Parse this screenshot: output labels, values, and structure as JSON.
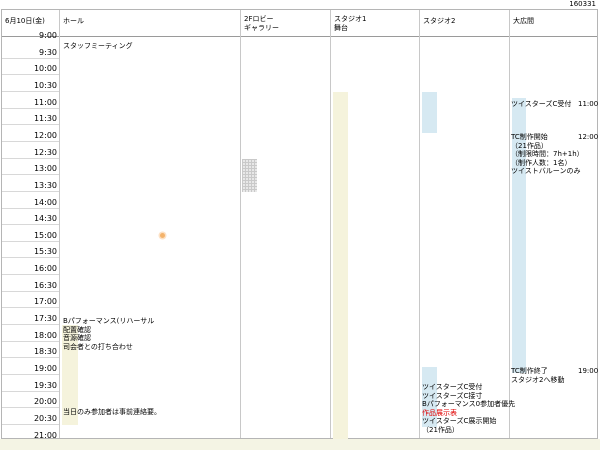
{
  "page_id": "160331",
  "header": {
    "date": "6月10日(金)",
    "columns": [
      {
        "key": "hall",
        "label": "ホール"
      },
      {
        "key": "lobby",
        "label": "2Fロビー\nギャラリー"
      },
      {
        "key": "studio1",
        "label": "スタジオ1\n舞台"
      },
      {
        "key": "studio2",
        "label": "スタジオ2"
      },
      {
        "key": "hiroma",
        "label": "大広間"
      }
    ]
  },
  "times": [
    "9:00",
    "9:30",
    "10:00",
    "10:30",
    "11:00",
    "11:30",
    "12:00",
    "12:30",
    "13:00",
    "13:30",
    "14:00",
    "14:30",
    "15:00",
    "15:30",
    "16:00",
    "16:30",
    "17:00",
    "17:30",
    "18:00",
    "18:30",
    "19:00",
    "19:30",
    "20:00",
    "20:30",
    "21:00"
  ],
  "events": {
    "hall_meeting": "スタッフミーティング",
    "hall_rehearsal": "Bパフォーマンス(リハーサル",
    "hall_placement": "配置確認",
    "hall_sound": "音源確認",
    "hall_mc": "司会者との打ち合わせ",
    "hall_note": "当日のみ参加者は事前連絡要。",
    "hiroma_reception": "ツイスターズC受付",
    "hiroma_reception_time": "11:00",
    "hiroma_start": "TC制作開始",
    "hiroma_start_time": "12:00",
    "hiroma_works": "（21作品）",
    "hiroma_limit": "（制限時間：7h+1h）",
    "hiroma_people": "（制作人数：1名）",
    "hiroma_balloon": "ツイストバルーンのみ",
    "hiroma_end": "TC制作終了",
    "hiroma_end_time": "19:00",
    "hiroma_move": "スタジオ2へ移動",
    "studio2_reception": "ツイスターズC受付",
    "studio2_removal": "ツイスターズC接寸",
    "studio2_priority": "Bパフォーマンス0参加者優先",
    "studio2_show": "作品展示表",
    "studio2_display": "ツイスターズC展示開始",
    "studio2_works": "（21作品）"
  },
  "colors": {
    "studio_bar": "#f5f3dc",
    "blue_bar": "#d6e9f2",
    "footer": "#f4f4e4",
    "red_text": "#e00000"
  }
}
